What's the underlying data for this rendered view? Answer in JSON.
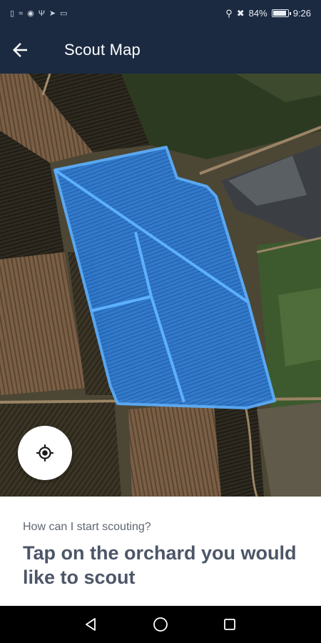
{
  "status_bar": {
    "battery_percent": "84%",
    "time": "9:26",
    "left_icons": [
      "sim-icon",
      "wifi-icon",
      "eye-icon",
      "usb-icon",
      "location-icon",
      "cast-icon"
    ],
    "right_icons": [
      "location-icon",
      "mute-icon",
      "battery-icon"
    ]
  },
  "app_bar": {
    "title": "Scout Map",
    "back_icon": "arrow-left-icon"
  },
  "map": {
    "locate_icon": "my-location-icon",
    "orchard_fill": "#3f8fe6",
    "orchard_stroke": "#5cb0ff"
  },
  "prompt": {
    "question": "How can I start scouting?",
    "instruction": "Tap on the orchard you would like to scout"
  },
  "nav": {
    "back_icon": "triangle-back-icon",
    "home_icon": "circle-home-icon",
    "recents_icon": "square-recents-icon"
  }
}
